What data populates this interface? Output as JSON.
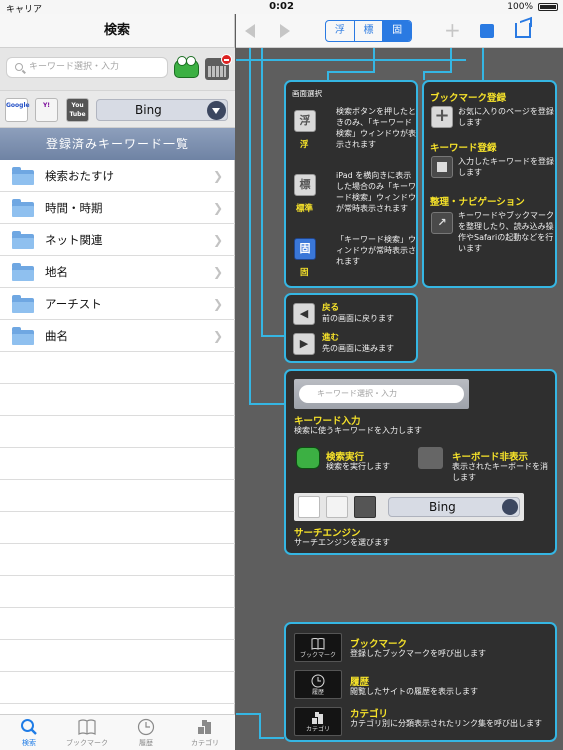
{
  "status": {
    "carrier": "キャリア",
    "time": "0:02",
    "battery": "100%"
  },
  "left": {
    "title": "検索",
    "search_placeholder": "キーワード選択・入力",
    "engines": {
      "google": "Google",
      "yahoo": "Y!",
      "youtube": "You Tube",
      "selected": "Bing"
    },
    "section_title": "登録済みキーワード一覧",
    "items": [
      "検索おたすけ",
      "時間・時期",
      "ネット関連",
      "地名",
      "アーチスト",
      "曲名"
    ],
    "tabs": [
      "検索",
      "ブックマーク",
      "履歴",
      "カテゴリ"
    ]
  },
  "toolbar": {
    "seg": [
      "浮",
      "標",
      "固"
    ]
  },
  "help": {
    "screen": {
      "title": "画面選択",
      "float_btn": "浮",
      "float_label": "浮",
      "float_desc": "検索ボタンを押したときのみ、「キーワード検索」ウィンドウが表示されます",
      "std_btn": "標",
      "std_label": "標準",
      "std_desc": "iPad を横向きに表示した場合のみ「キーワード検索」ウィンドウが常時表示されます",
      "fix_btn": "固",
      "fix_label": "固",
      "fix_desc": "「キーワード検索」ウィンドウが常時表示されます"
    },
    "bookmark": {
      "title": "ブックマーク登録",
      "desc": "お気に入りのページを登録します",
      "kw_title": "キーワード登録",
      "kw_desc": "入力したキーワードを登録します",
      "org_title": "整理・ナビゲーション",
      "org_desc": "キーワードやブックマークを整理したり、読み込み操作やSafariの起動などを行います"
    },
    "nav": {
      "back_title": "戻る",
      "back_desc": "前の画面に戻ります",
      "fwd_title": "進む",
      "fwd_desc": "先の画面に進みます"
    },
    "keyword": {
      "placeholder": "キーワード選択・入力",
      "input_title": "キーワード入力",
      "input_desc": "検索に使うキーワードを入力します",
      "exec_title": "検索実行",
      "exec_desc": "検索を実行します",
      "kb_title": "キーボード非表示",
      "kb_desc": "表示されたキーボードを消します",
      "engine_selected": "Bing",
      "engine_title": "サーチエンジン",
      "engine_desc": "サーチエンジンを選びます"
    },
    "tabs": {
      "bm_icon": "ブックマーク",
      "bm_title": "ブックマーク",
      "bm_desc": "登録したブックマークを呼び出します",
      "hist_icon": "履歴",
      "hist_title": "履歴",
      "hist_desc": "閲覧したサイトの履歴を表示します",
      "cat_icon": "カテゴリ",
      "cat_title": "カテゴリ",
      "cat_desc": "カテゴリ別に分類表示されたリンク集を呼び出します"
    }
  }
}
